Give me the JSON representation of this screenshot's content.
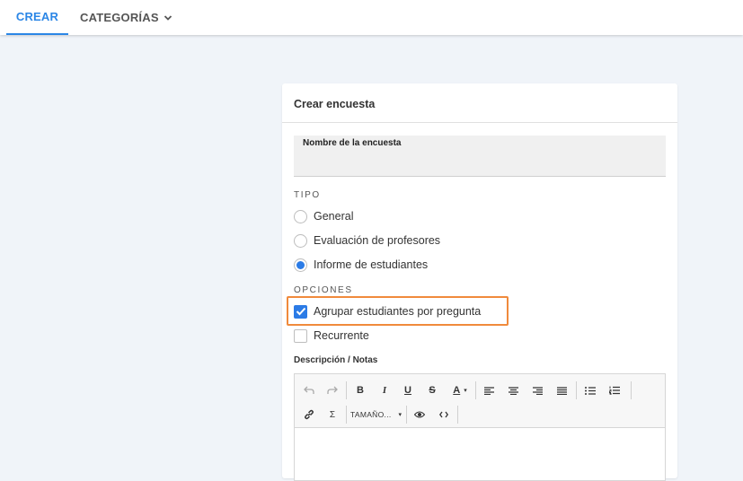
{
  "nav": {
    "tabs": [
      {
        "label": "CREAR",
        "active": true
      },
      {
        "label": "CATEGORÍAS",
        "active": false,
        "has_dropdown": true
      }
    ]
  },
  "card": {
    "title": "Crear encuesta",
    "name_field": {
      "label": "Nombre de la encuesta",
      "value": ""
    },
    "tipo": {
      "label": "TIPO",
      "options": [
        {
          "label": "General",
          "selected": false
        },
        {
          "label": "Evaluación de profesores",
          "selected": false
        },
        {
          "label": "Informe de estudiantes",
          "selected": true
        }
      ]
    },
    "opciones": {
      "label": "OPCIONES",
      "options": [
        {
          "label": "Agrupar estudiantes por pregunta",
          "checked": true,
          "highlighted": true
        },
        {
          "label": "Recurrente",
          "checked": false
        }
      ]
    },
    "description": {
      "label": "Descripción / Notas",
      "toolbar": {
        "buttons": [
          "undo-icon",
          "redo-icon",
          "bold-icon",
          "italic-icon",
          "underline-icon",
          "strikethrough-icon",
          "font-color-icon",
          "align-left-icon",
          "align-center-icon",
          "align-right-icon",
          "align-justify-icon",
          "bullet-list-icon",
          "numbered-list-icon",
          "link-icon",
          "sigma-icon",
          "eye-icon",
          "code-icon"
        ],
        "size_label": "TAMAÑO..."
      },
      "value": ""
    }
  },
  "colors": {
    "accent": "#2b86e6",
    "check": "#2b7be6",
    "highlight": "#f08a3c",
    "background": "#f0f4f9"
  }
}
